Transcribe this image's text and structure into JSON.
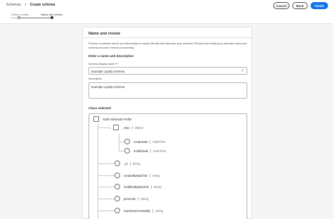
{
  "header": {
    "breadcrumb_root": "Schemas",
    "breadcrumb_separator": ">",
    "breadcrumb_current": "Create schema",
    "cancel_label": "Cancel",
    "back_label": "Back",
    "finish_label": "Finish"
  },
  "steps": {
    "step1": "Select a class",
    "step2": "Name and review"
  },
  "card": {
    "title": "Name and review",
    "description": "Provide a suitable name and description to easily identify and discover your schema. Review and verify your selected class and schema structure before proceeding.",
    "section_title": "Enter a name and description",
    "display_name_label": "Schema display name ✶",
    "display_name_value": "Example Loyalty Schema",
    "description_label": "Description",
    "description_value": "Example Loyalty Schema",
    "class_selected_title": "Class selected"
  },
  "tree": {
    "root": "XDM Individual Profile",
    "repo": {
      "name": "_repo",
      "type": "Object"
    },
    "repo_children": [
      {
        "name": "createDate",
        "type": "DateTime"
      },
      {
        "name": "modifyDate",
        "type": "DateTime"
      }
    ],
    "fields": [
      {
        "name": "_id",
        "type": "String"
      },
      {
        "name": "createdByBatchID",
        "type": "String"
      },
      {
        "name": "modifiedByBatchID",
        "type": "String"
      },
      {
        "name": "personID",
        "type": "String"
      },
      {
        "name": "repositoryCreatedBy",
        "type": "String"
      }
    ]
  },
  "colors": {
    "accent": "#1473e6",
    "valid": "#2d9d78"
  }
}
